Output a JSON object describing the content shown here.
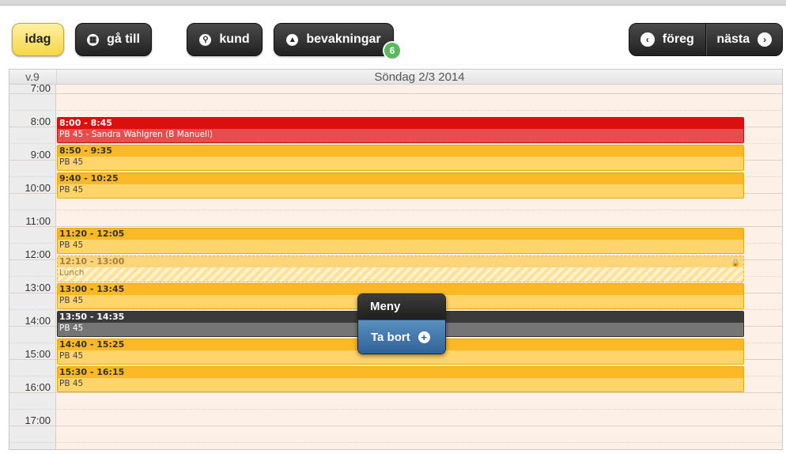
{
  "toolbar": {
    "today_label": "idag",
    "goto_label": "gå till",
    "customer_label": "kund",
    "watch_label": "bevakningar",
    "watch_count": "6",
    "prev_label": "föreg",
    "next_label": "nästa"
  },
  "icons": {
    "goto": "calendar-icon",
    "customer": "search-icon",
    "watch": "warning-icon",
    "prev": "chevron-left-icon",
    "next": "chevron-right-icon",
    "lock": "lock-icon",
    "add": "plus-icon"
  },
  "calendar": {
    "week_label": "v.9",
    "day_title": "Söndag 2/3 2014",
    "hours": [
      "7:00",
      "8:00",
      "9:00",
      "10:00",
      "11:00",
      "12:00",
      "13:00",
      "14:00",
      "15:00",
      "16:00",
      "17:00"
    ],
    "events": [
      {
        "time": "8:00 - 8:45",
        "text": "PB 45 - Sandra Wahlgren (B Manuell)",
        "status": "red"
      },
      {
        "time": "8:50 - 9:35",
        "text": "PB 45",
        "status": "yellow"
      },
      {
        "time": "9:40 - 10:25",
        "text": "PB 45",
        "status": "yellow"
      },
      {
        "time": "11:20 - 12:05",
        "text": "PB 45",
        "status": "yellow"
      },
      {
        "time": "12:10 - 13:00",
        "text": "Lunch",
        "status": "locked"
      },
      {
        "time": "13:00 - 13:45",
        "text": "PB 45",
        "status": "yellow"
      },
      {
        "time": "13:50 - 14:35",
        "text": "PB 45",
        "status": "selected"
      },
      {
        "time": "14:40 - 15:25",
        "text": "PB 45",
        "status": "yellow"
      },
      {
        "time": "15:30 - 16:15",
        "text": "PB 45",
        "status": "yellow"
      }
    ]
  },
  "popup": {
    "title": "Meny",
    "item_label": "Ta bort"
  },
  "colors": {
    "booked_red": "#dc0f0f",
    "slot_yellow": "#fbb827",
    "selected_dark": "#3a3a3a",
    "badge_green": "#5cb85c",
    "menu_blue": "#2f6196"
  }
}
